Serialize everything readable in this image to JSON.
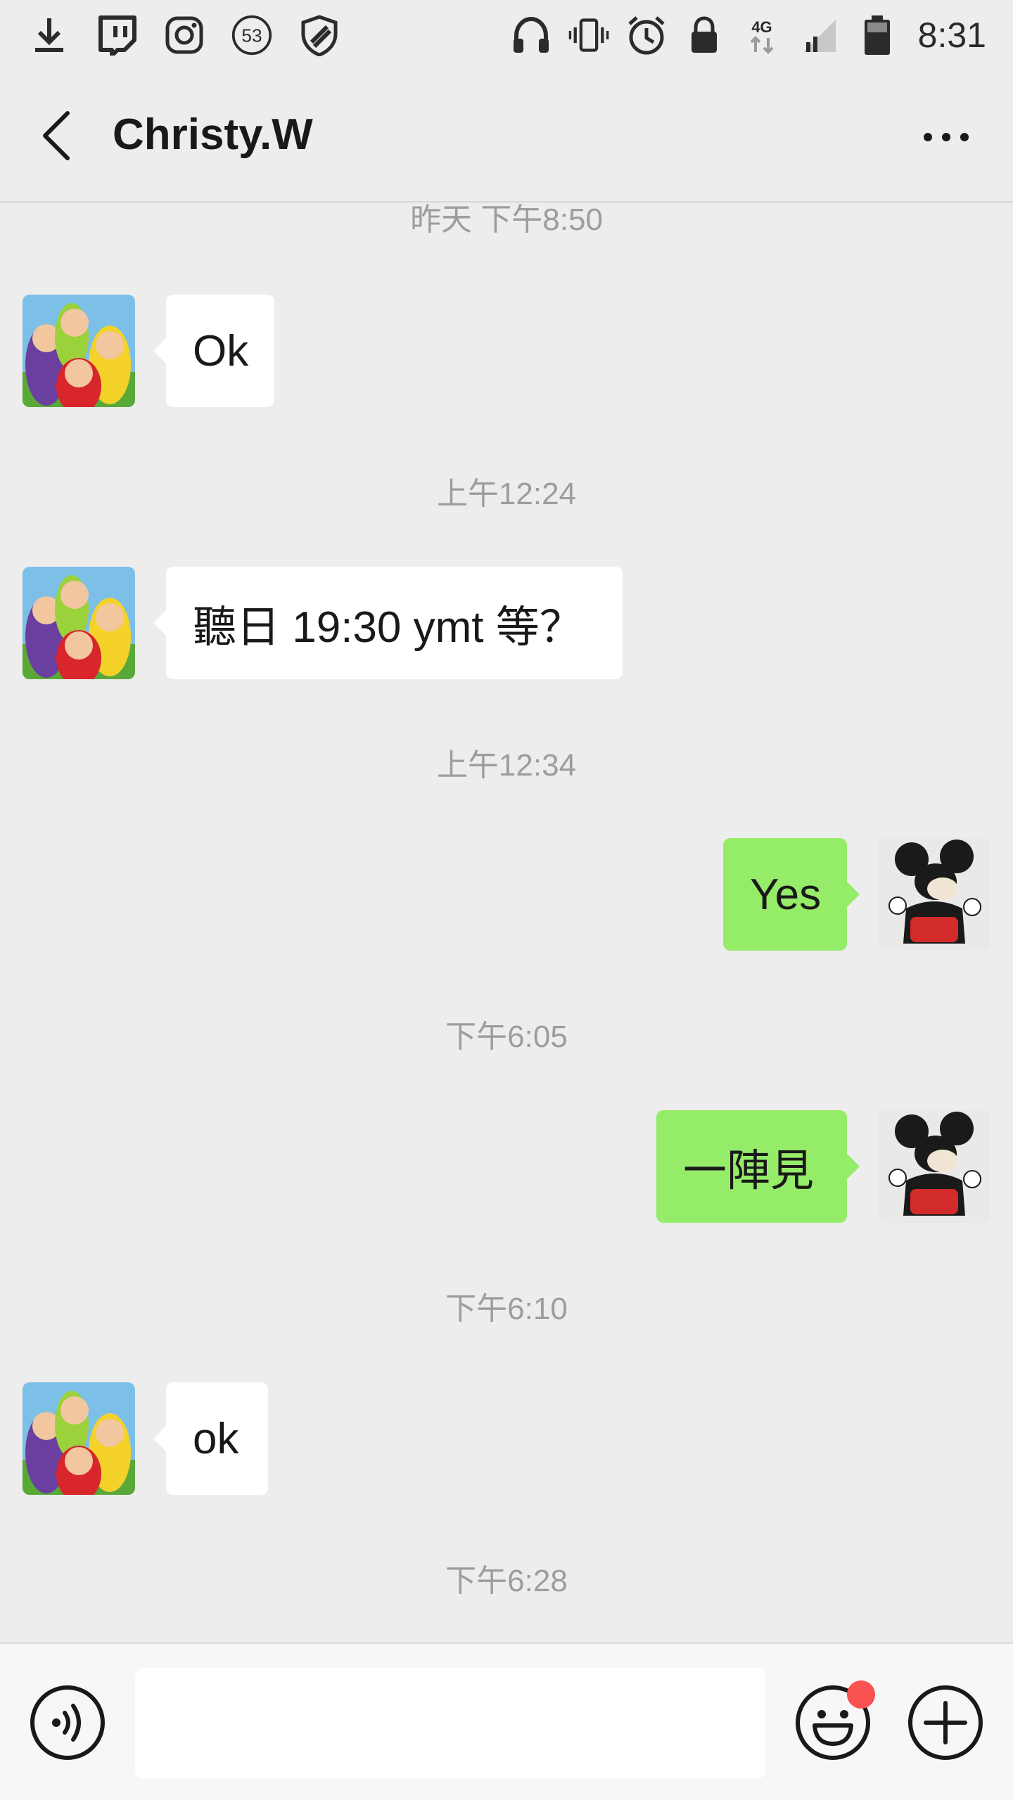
{
  "status_bar": {
    "notification_count": "53",
    "network": "4G",
    "time": "8:31"
  },
  "header": {
    "title": "Christy.W"
  },
  "messages": [
    {
      "kind": "timestamp",
      "text": "昨天 下午8:50"
    },
    {
      "kind": "incoming",
      "text": "Ok",
      "avatar": "teletubbies-avatar"
    },
    {
      "kind": "timestamp",
      "text": "上午12:24"
    },
    {
      "kind": "incoming",
      "text": "聽日 19:30 ymt 等？",
      "avatar": "teletubbies-avatar"
    },
    {
      "kind": "timestamp",
      "text": "上午12:34"
    },
    {
      "kind": "outgoing",
      "text": "Yes",
      "avatar": "mickey-avatar"
    },
    {
      "kind": "timestamp",
      "text": "下午6:05"
    },
    {
      "kind": "outgoing",
      "text": "一陣見",
      "avatar": "mickey-avatar"
    },
    {
      "kind": "timestamp",
      "text": "下午6:10"
    },
    {
      "kind": "incoming",
      "text": "ok",
      "avatar": "teletubbies-avatar"
    },
    {
      "kind": "timestamp",
      "text": "下午6:28"
    }
  ],
  "input_bar": {
    "text_value": "",
    "emoji_has_badge": true
  },
  "colors": {
    "background": "#ededed",
    "outgoing_bubble": "#95ec69",
    "incoming_bubble": "#ffffff",
    "badge": "#fa5151"
  }
}
